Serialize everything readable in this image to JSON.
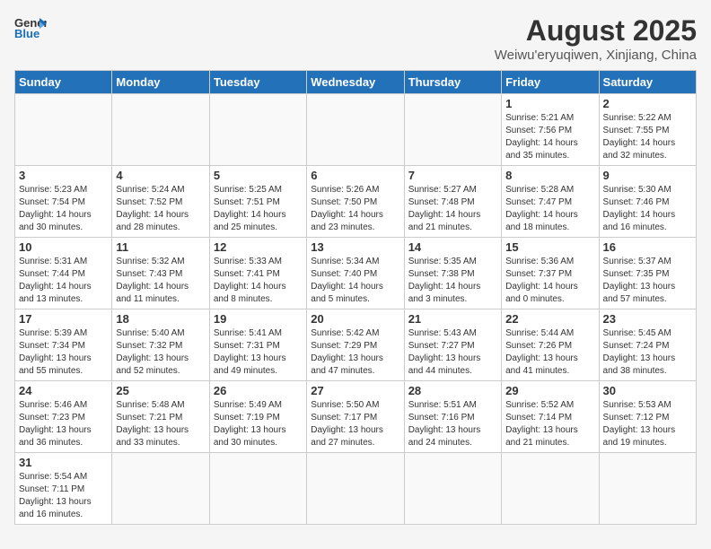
{
  "header": {
    "logo_general": "General",
    "logo_blue": "Blue",
    "month_title": "August 2025",
    "location": "Weiwu'eryuqiwen, Xinjiang, China"
  },
  "weekdays": [
    "Sunday",
    "Monday",
    "Tuesday",
    "Wednesday",
    "Thursday",
    "Friday",
    "Saturday"
  ],
  "weeks": [
    [
      {
        "day": "",
        "info": ""
      },
      {
        "day": "",
        "info": ""
      },
      {
        "day": "",
        "info": ""
      },
      {
        "day": "",
        "info": ""
      },
      {
        "day": "",
        "info": ""
      },
      {
        "day": "1",
        "info": "Sunrise: 5:21 AM\nSunset: 7:56 PM\nDaylight: 14 hours and 35 minutes."
      },
      {
        "day": "2",
        "info": "Sunrise: 5:22 AM\nSunset: 7:55 PM\nDaylight: 14 hours and 32 minutes."
      }
    ],
    [
      {
        "day": "3",
        "info": "Sunrise: 5:23 AM\nSunset: 7:54 PM\nDaylight: 14 hours and 30 minutes."
      },
      {
        "day": "4",
        "info": "Sunrise: 5:24 AM\nSunset: 7:52 PM\nDaylight: 14 hours and 28 minutes."
      },
      {
        "day": "5",
        "info": "Sunrise: 5:25 AM\nSunset: 7:51 PM\nDaylight: 14 hours and 25 minutes."
      },
      {
        "day": "6",
        "info": "Sunrise: 5:26 AM\nSunset: 7:50 PM\nDaylight: 14 hours and 23 minutes."
      },
      {
        "day": "7",
        "info": "Sunrise: 5:27 AM\nSunset: 7:48 PM\nDaylight: 14 hours and 21 minutes."
      },
      {
        "day": "8",
        "info": "Sunrise: 5:28 AM\nSunset: 7:47 PM\nDaylight: 14 hours and 18 minutes."
      },
      {
        "day": "9",
        "info": "Sunrise: 5:30 AM\nSunset: 7:46 PM\nDaylight: 14 hours and 16 minutes."
      }
    ],
    [
      {
        "day": "10",
        "info": "Sunrise: 5:31 AM\nSunset: 7:44 PM\nDaylight: 14 hours and 13 minutes."
      },
      {
        "day": "11",
        "info": "Sunrise: 5:32 AM\nSunset: 7:43 PM\nDaylight: 14 hours and 11 minutes."
      },
      {
        "day": "12",
        "info": "Sunrise: 5:33 AM\nSunset: 7:41 PM\nDaylight: 14 hours and 8 minutes."
      },
      {
        "day": "13",
        "info": "Sunrise: 5:34 AM\nSunset: 7:40 PM\nDaylight: 14 hours and 5 minutes."
      },
      {
        "day": "14",
        "info": "Sunrise: 5:35 AM\nSunset: 7:38 PM\nDaylight: 14 hours and 3 minutes."
      },
      {
        "day": "15",
        "info": "Sunrise: 5:36 AM\nSunset: 7:37 PM\nDaylight: 14 hours and 0 minutes."
      },
      {
        "day": "16",
        "info": "Sunrise: 5:37 AM\nSunset: 7:35 PM\nDaylight: 13 hours and 57 minutes."
      }
    ],
    [
      {
        "day": "17",
        "info": "Sunrise: 5:39 AM\nSunset: 7:34 PM\nDaylight: 13 hours and 55 minutes."
      },
      {
        "day": "18",
        "info": "Sunrise: 5:40 AM\nSunset: 7:32 PM\nDaylight: 13 hours and 52 minutes."
      },
      {
        "day": "19",
        "info": "Sunrise: 5:41 AM\nSunset: 7:31 PM\nDaylight: 13 hours and 49 minutes."
      },
      {
        "day": "20",
        "info": "Sunrise: 5:42 AM\nSunset: 7:29 PM\nDaylight: 13 hours and 47 minutes."
      },
      {
        "day": "21",
        "info": "Sunrise: 5:43 AM\nSunset: 7:27 PM\nDaylight: 13 hours and 44 minutes."
      },
      {
        "day": "22",
        "info": "Sunrise: 5:44 AM\nSunset: 7:26 PM\nDaylight: 13 hours and 41 minutes."
      },
      {
        "day": "23",
        "info": "Sunrise: 5:45 AM\nSunset: 7:24 PM\nDaylight: 13 hours and 38 minutes."
      }
    ],
    [
      {
        "day": "24",
        "info": "Sunrise: 5:46 AM\nSunset: 7:23 PM\nDaylight: 13 hours and 36 minutes."
      },
      {
        "day": "25",
        "info": "Sunrise: 5:48 AM\nSunset: 7:21 PM\nDaylight: 13 hours and 33 minutes."
      },
      {
        "day": "26",
        "info": "Sunrise: 5:49 AM\nSunset: 7:19 PM\nDaylight: 13 hours and 30 minutes."
      },
      {
        "day": "27",
        "info": "Sunrise: 5:50 AM\nSunset: 7:17 PM\nDaylight: 13 hours and 27 minutes."
      },
      {
        "day": "28",
        "info": "Sunrise: 5:51 AM\nSunset: 7:16 PM\nDaylight: 13 hours and 24 minutes."
      },
      {
        "day": "29",
        "info": "Sunrise: 5:52 AM\nSunset: 7:14 PM\nDaylight: 13 hours and 21 minutes."
      },
      {
        "day": "30",
        "info": "Sunrise: 5:53 AM\nSunset: 7:12 PM\nDaylight: 13 hours and 19 minutes."
      }
    ],
    [
      {
        "day": "31",
        "info": "Sunrise: 5:54 AM\nSunset: 7:11 PM\nDaylight: 13 hours and 16 minutes."
      },
      {
        "day": "",
        "info": ""
      },
      {
        "day": "",
        "info": ""
      },
      {
        "day": "",
        "info": ""
      },
      {
        "day": "",
        "info": ""
      },
      {
        "day": "",
        "info": ""
      },
      {
        "day": "",
        "info": ""
      }
    ]
  ]
}
